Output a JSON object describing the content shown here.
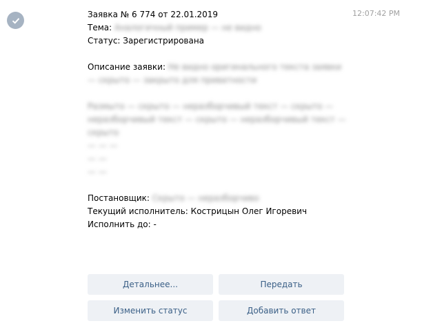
{
  "message": {
    "time": "12:07:42 PM",
    "header": "Заявка № 6 774 от 22.01.2019",
    "topic_label": "Тема:",
    "topic_value": "Аналогичный пример — не видно",
    "status_label": "Статус:",
    "status_value": "Зарегистрирована",
    "description_label": "Описание заявки:",
    "description_value_1": "Не видно оригинального текста заявки — скрыто — закрыто для приватности",
    "description_value_2": "Размыто — скрыто — неразборчивый текст — скрыто — неразборчивый текст — скрыто — неразборчивый текст — скрыто",
    "description_lines": [
      "— — —",
      "— —",
      "— —"
    ],
    "author_label": "Постановщик:",
    "author_value": "Скрыто — неразборчиво",
    "executor_label": "Текущий исполнитель:",
    "executor_value": "Кострицын Олег Игоревич",
    "due_label": "Исполнить до:",
    "due_value": "-"
  },
  "buttons": {
    "details": "Детальнее...",
    "transfer": "Передать",
    "change_status": "Изменить статус",
    "add_reply": "Добавить ответ"
  },
  "icons": {
    "avatar": "check-icon"
  },
  "colors": {
    "avatar": "#a6b3c2",
    "button_bg": "#eef1f5",
    "button_text": "#3a5f86"
  }
}
